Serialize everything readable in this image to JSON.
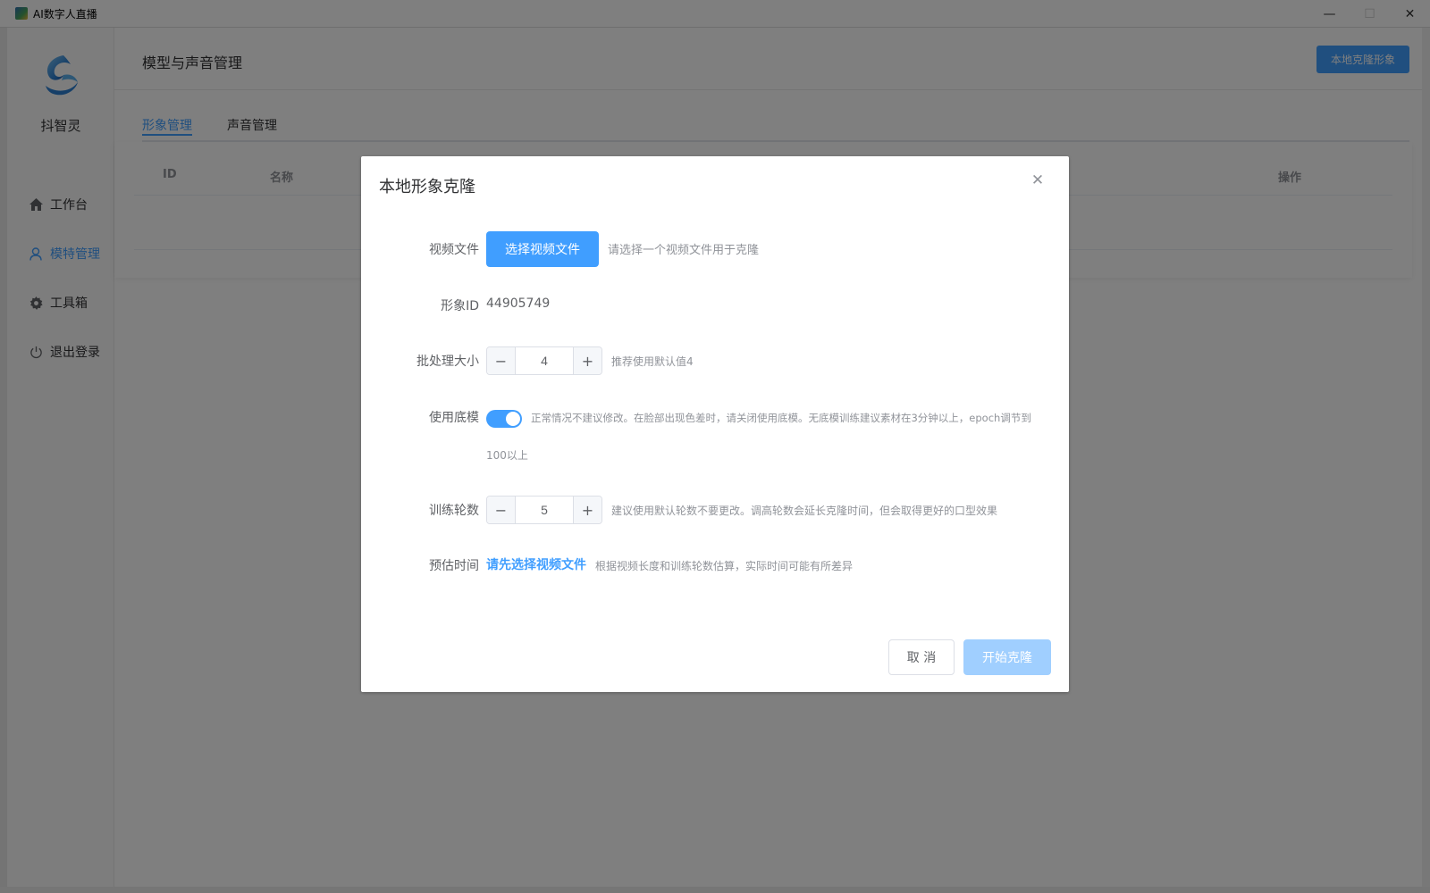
{
  "window": {
    "title": "AI数字人直播",
    "minimize": "—",
    "maximize": "☐",
    "close": "✕"
  },
  "sidebar": {
    "brand": "抖智灵",
    "items": [
      {
        "label": "工作台",
        "icon": "home-icon"
      },
      {
        "label": "模特管理",
        "icon": "user-icon",
        "active": true
      },
      {
        "label": "工具箱",
        "icon": "gear-icon"
      },
      {
        "label": "退出登录",
        "icon": "power-icon"
      }
    ]
  },
  "header": {
    "title": "模型与声音管理",
    "action_button": "本地克隆形象"
  },
  "tabs": [
    {
      "label": "形象管理",
      "active": true
    },
    {
      "label": "声音管理",
      "active": false
    }
  ],
  "table": {
    "columns": [
      "ID",
      "名称",
      "操作"
    ]
  },
  "dialog": {
    "title": "本地形象克隆",
    "video_file": {
      "label": "视频文件",
      "button": "选择视频文件",
      "hint": "请选择一个视频文件用于克隆"
    },
    "avatar_id": {
      "label": "形象ID",
      "value": "44905749"
    },
    "batch_size": {
      "label": "批处理大小",
      "value": "4",
      "hint": "推荐使用默认值4"
    },
    "use_base_model": {
      "label": "使用底模",
      "on": true,
      "hint_line1": "正常情况不建议修改。在脸部出现色差时，请关闭使用底模。无底模训练建议素材在3分钟以上，epoch调节到",
      "hint_line2": "100以上"
    },
    "epochs": {
      "label": "训练轮数",
      "value": "5",
      "hint": "建议使用默认轮数不要更改。调高轮数会延长克隆时间，但会取得更好的口型效果"
    },
    "estimated_time": {
      "label": "预估时间",
      "value": "请先选择视频文件",
      "hint": "根据视频长度和训练轮数估算，实际时间可能有所差异"
    },
    "stepper_minus": "−",
    "stepper_plus": "+",
    "cancel_button": "取 消",
    "start_button": "开始克隆"
  },
  "colors": {
    "primary": "#409eff",
    "primary_disabled": "#a0cfff",
    "overlay": "rgba(0,0,0,0.5)"
  }
}
